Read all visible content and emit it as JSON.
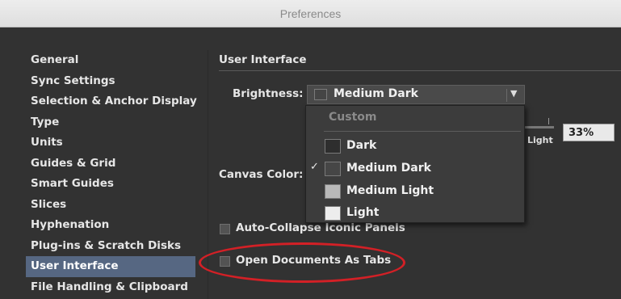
{
  "window": {
    "title": "Preferences"
  },
  "sidebar": {
    "items": [
      {
        "label": "General",
        "selected": false
      },
      {
        "label": "Sync Settings",
        "selected": false
      },
      {
        "label": "Selection & Anchor Display",
        "selected": false
      },
      {
        "label": "Type",
        "selected": false
      },
      {
        "label": "Units",
        "selected": false
      },
      {
        "label": "Guides & Grid",
        "selected": false
      },
      {
        "label": "Smart Guides",
        "selected": false
      },
      {
        "label": "Slices",
        "selected": false
      },
      {
        "label": "Hyphenation",
        "selected": false
      },
      {
        "label": "Plug-ins & Scratch Disks",
        "selected": false
      },
      {
        "label": "User Interface",
        "selected": true
      },
      {
        "label": "File Handling & Clipboard",
        "selected": false
      }
    ]
  },
  "panel": {
    "section_title": "User Interface",
    "brightness": {
      "label": "Brightness:",
      "selected_value": "Medium Dark",
      "swatch_color": "#454545",
      "dropdown": {
        "header": "Custom",
        "options": [
          {
            "label": "Dark",
            "color": "#2e2e2e",
            "checked": false
          },
          {
            "label": "Medium Dark",
            "color": "#464646",
            "checked": true,
            "check_mark": "✓"
          },
          {
            "label": "Medium Light",
            "color": "#b9b9b9",
            "checked": false
          },
          {
            "label": "Light",
            "color": "#ededed",
            "checked": false
          }
        ]
      }
    },
    "brightness_slider": {
      "end_label": "Light",
      "percent_value": "33%"
    },
    "canvas_color": {
      "label": "Canvas Color:"
    },
    "auto_collapse": {
      "label": "Auto-Collapse Iconic Panels",
      "checked": false
    },
    "open_as_tabs": {
      "label": "Open Documents As Tabs",
      "checked": false
    }
  },
  "annotation": {
    "highlight_color": "#d32026"
  }
}
